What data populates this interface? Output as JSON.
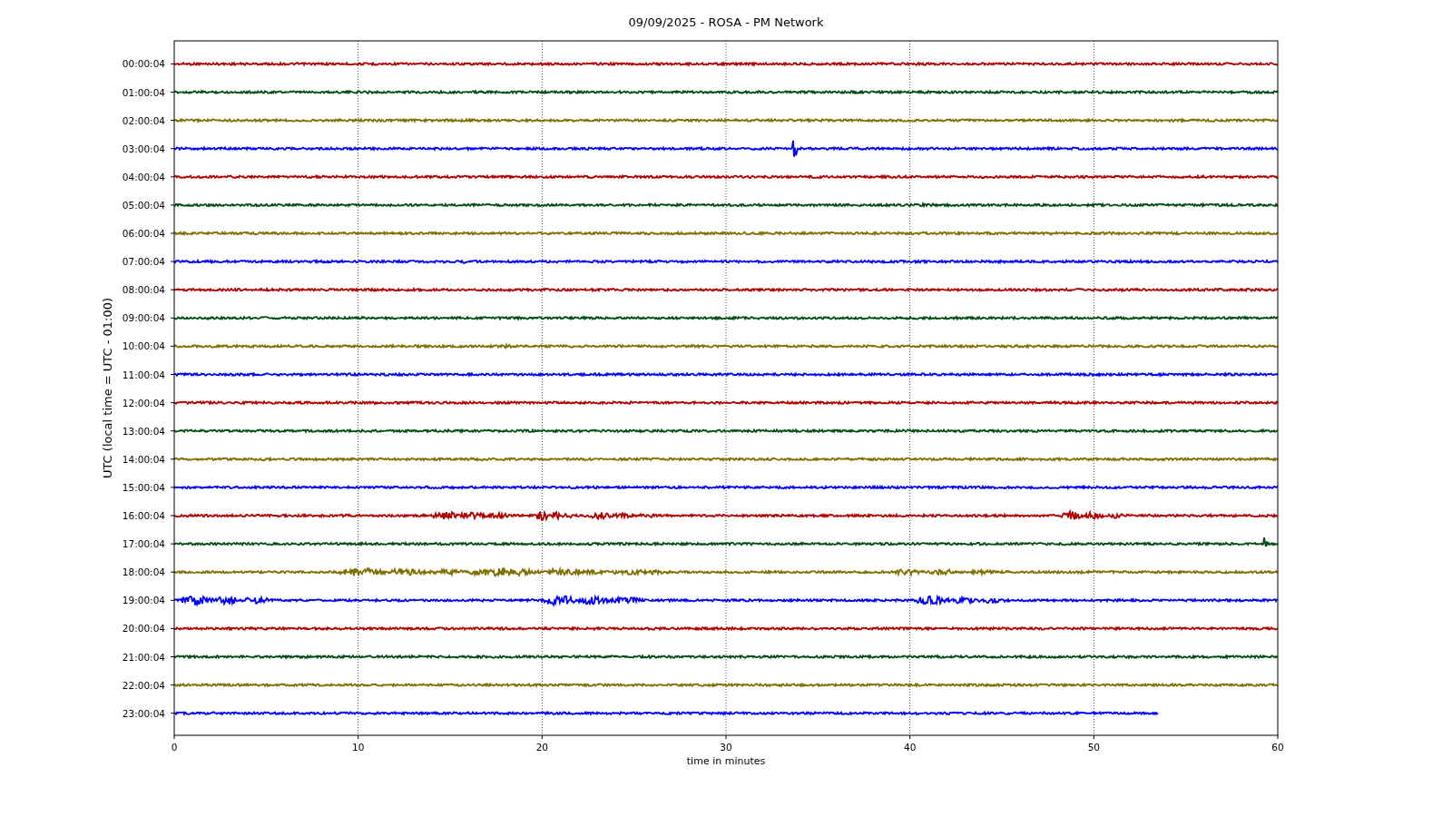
{
  "title": "09/09/2025 - ROSA - PM Network",
  "xlabel": "time in minutes",
  "ylabel": "UTC (local time = UTC - 01:00)",
  "xticks": [
    "0",
    "10",
    "20",
    "30",
    "40",
    "50",
    "60"
  ],
  "traces": [
    {
      "label": "00:00:04",
      "color": "#b00000"
    },
    {
      "label": "01:00:04",
      "color": "#004d14"
    },
    {
      "label": "02:00:04",
      "color": "#807000"
    },
    {
      "label": "03:00:04",
      "color": "#0000ff"
    },
    {
      "label": "04:00:04",
      "color": "#b00000"
    },
    {
      "label": "05:00:04",
      "color": "#004d14"
    },
    {
      "label": "06:00:04",
      "color": "#807000"
    },
    {
      "label": "07:00:04",
      "color": "#0000ff"
    },
    {
      "label": "08:00:04",
      "color": "#b00000"
    },
    {
      "label": "09:00:04",
      "color": "#004d14"
    },
    {
      "label": "10:00:04",
      "color": "#807000"
    },
    {
      "label": "11:00:04",
      "color": "#0000ff"
    },
    {
      "label": "12:00:04",
      "color": "#b00000"
    },
    {
      "label": "13:00:04",
      "color": "#004d14"
    },
    {
      "label": "14:00:04",
      "color": "#807000"
    },
    {
      "label": "15:00:04",
      "color": "#0000ff"
    },
    {
      "label": "16:00:04",
      "color": "#b00000"
    },
    {
      "label": "17:00:04",
      "color": "#004d14"
    },
    {
      "label": "18:00:04",
      "color": "#807000"
    },
    {
      "label": "19:00:04",
      "color": "#0000ff"
    },
    {
      "label": "20:00:04",
      "color": "#b00000"
    },
    {
      "label": "21:00:04",
      "color": "#004d14"
    },
    {
      "label": "22:00:04",
      "color": "#807000"
    },
    {
      "label": "23:00:04",
      "color": "#0000ff",
      "kind": "partial"
    }
  ]
}
